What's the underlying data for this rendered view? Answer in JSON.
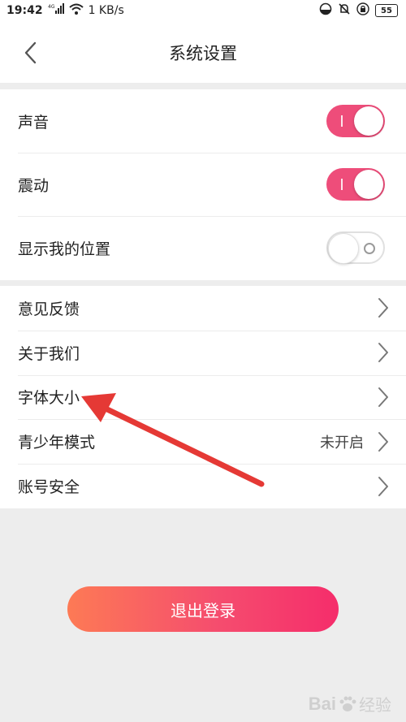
{
  "status_bar": {
    "time": "19:42",
    "network_speed": "1 KB/s",
    "battery": "55",
    "icons": [
      "signal-4g-icon",
      "wifi-icon",
      "data-saver-icon",
      "silent-bell-icon",
      "lock-icon",
      "battery-icon"
    ]
  },
  "nav": {
    "title": "系统设置",
    "back_icon": "chevron-left-icon"
  },
  "toggles": [
    {
      "label": "声音",
      "on": true
    },
    {
      "label": "震动",
      "on": true
    },
    {
      "label": "显示我的位置",
      "on": false
    }
  ],
  "menu": [
    {
      "label": "意见反馈",
      "value": ""
    },
    {
      "label": "关于我们",
      "value": ""
    },
    {
      "label": "字体大小",
      "value": ""
    },
    {
      "label": "青少年模式",
      "value": "未开启"
    },
    {
      "label": "账号安全",
      "value": ""
    }
  ],
  "logout_label": "退出登录",
  "colors": {
    "accent": "#ee4d7a",
    "button_gradient_start": "#fd7a55",
    "button_gradient_end": "#f52d6b",
    "annotation_arrow": "#e53935",
    "background": "#ededed"
  },
  "annotation": {
    "type": "arrow",
    "target": "字体大小"
  },
  "watermark": {
    "logo": "baidu-paw-logo",
    "text_a": "Bai",
    "text_b": "经验"
  }
}
